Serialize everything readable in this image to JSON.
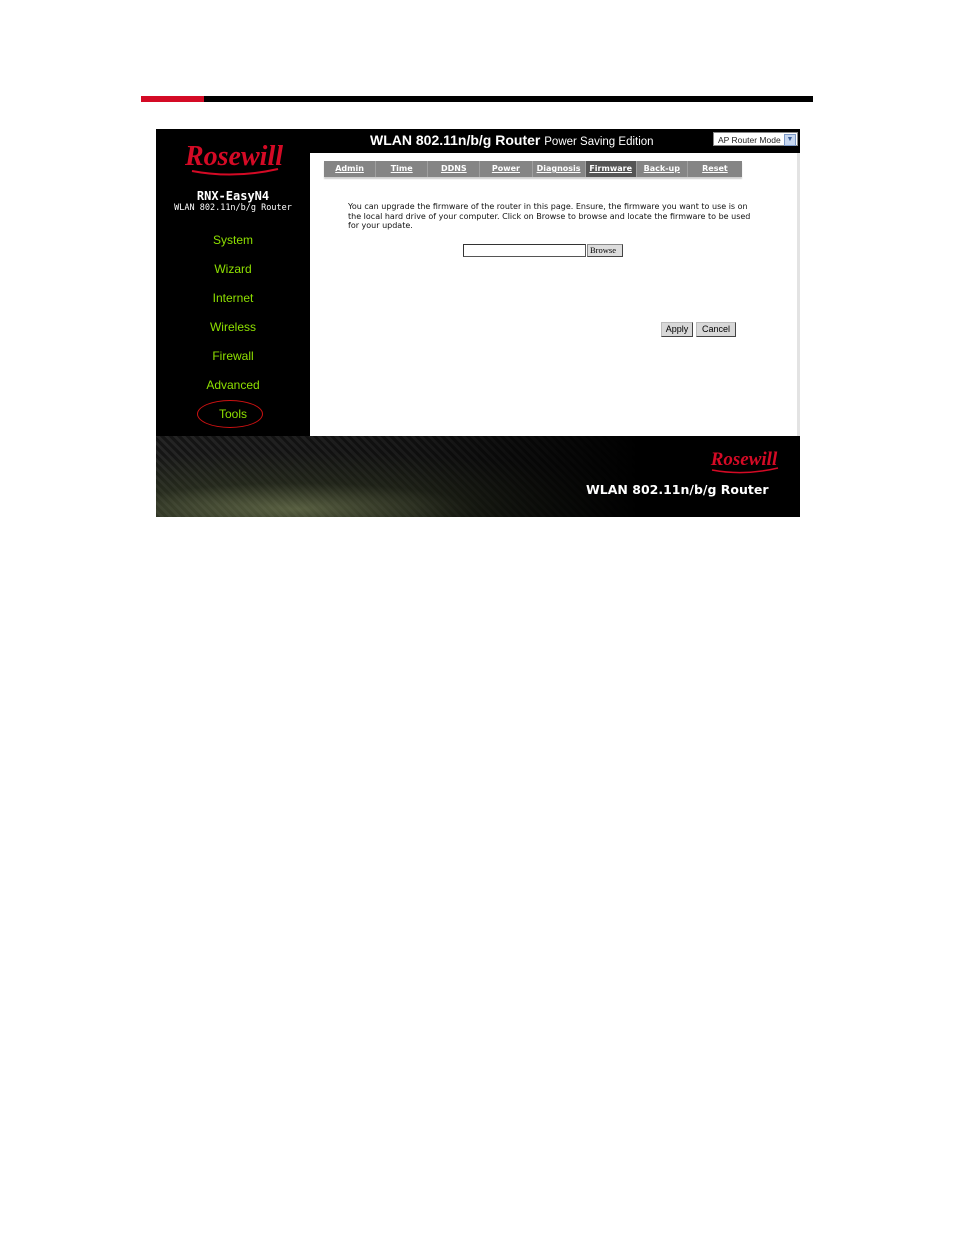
{
  "brand": {
    "logo_text": "Rosewill",
    "model": "RNX-EasyN4",
    "model_subtitle": "WLAN 802.11n/b/g Router"
  },
  "header": {
    "title": "WLAN 802.11n/b/g Router",
    "subtitle": "Power Saving Edition",
    "mode_select": {
      "value": "AP Router Mode"
    }
  },
  "sidebar": {
    "items": [
      {
        "label": "System"
      },
      {
        "label": "Wizard"
      },
      {
        "label": "Internet"
      },
      {
        "label": "Wireless"
      },
      {
        "label": "Firewall"
      },
      {
        "label": "Advanced"
      },
      {
        "label": "Tools",
        "highlighted": true
      }
    ]
  },
  "tabs": [
    {
      "label": "Admin"
    },
    {
      "label": "Time"
    },
    {
      "label": "DDNS"
    },
    {
      "label": "Power"
    },
    {
      "label": "Diagnosis"
    },
    {
      "label": "Firmware",
      "active": true
    },
    {
      "label": "Back-up"
    },
    {
      "label": "Reset"
    }
  ],
  "main": {
    "description": "You can upgrade the firmware of the router in this page. Ensure, the firmware you want to use is on the local hard drive of your computer. Click on Browse to browse and locate the firmware to be used for your update.",
    "file_input_value": "",
    "browse_label": "Browse",
    "apply_label": "Apply",
    "cancel_label": "Cancel"
  },
  "footer": {
    "logo_text": "Rosewill",
    "title": "WLAN 802.11n/b/g Router"
  },
  "colors": {
    "accent_red": "#d40a25",
    "nav_green": "#8ee000",
    "tab_gray": "#858585",
    "tab_active": "#555555"
  }
}
